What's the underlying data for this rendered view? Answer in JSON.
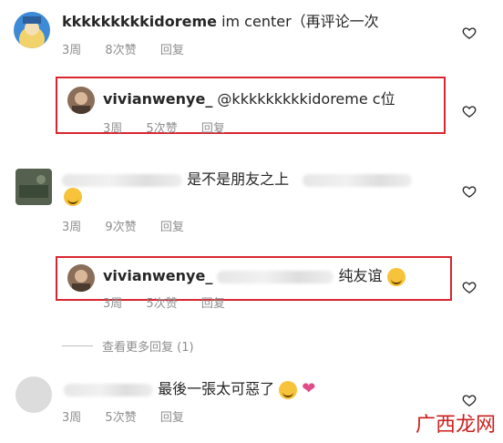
{
  "comments": [
    {
      "username": "kkkkkkkkkidoreme",
      "text": "im center（再评论一次",
      "time": "3周",
      "likes": "8次赞",
      "reply": "回复"
    },
    {
      "username": "vivianwenye_",
      "text": "@kkkkkkkkkidoreme c位",
      "time": "3周",
      "likes": "5次赞",
      "reply": "回复"
    },
    {
      "username": "",
      "text": "是不是朋友之上",
      "time": "3周",
      "likes": "9次赞",
      "reply": "回复"
    },
    {
      "username": "vivianwenye_",
      "text": "纯友谊",
      "time": "3周",
      "likes": "5次赞",
      "reply": "回复"
    },
    {
      "username": "",
      "text": "最後一張太可惡了",
      "time": "3周",
      "likes": "5次赞",
      "reply": "回复"
    }
  ],
  "view_more": "查看更多回复 (1)",
  "watermark": "广西龙网",
  "colors": {
    "highlight_box": "#d9252f",
    "meta": "#8e8e8e",
    "text": "#262626"
  }
}
